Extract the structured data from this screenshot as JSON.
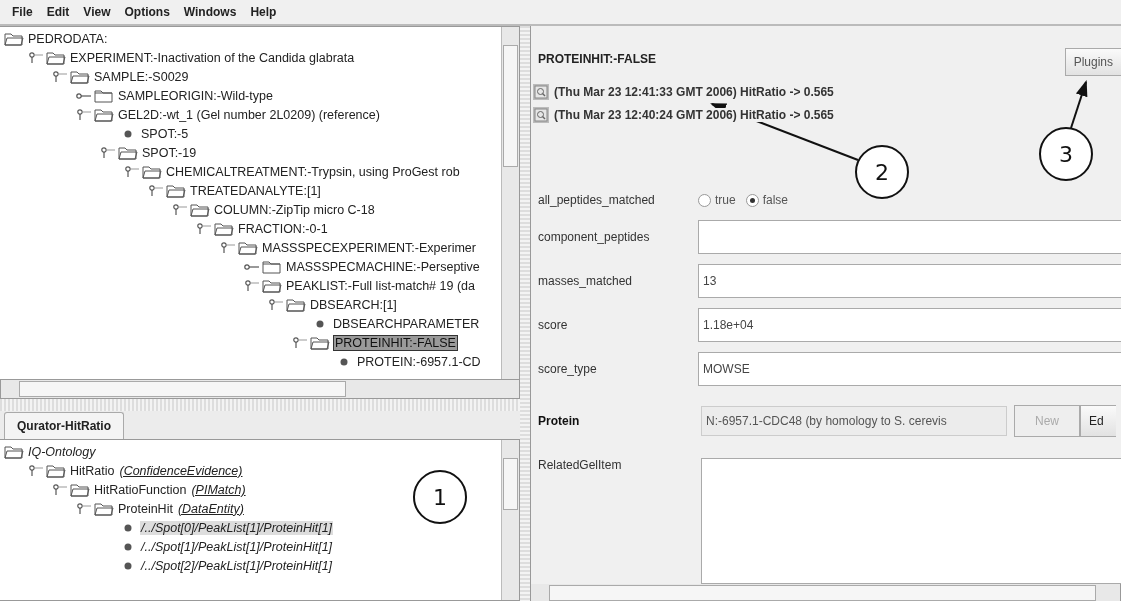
{
  "menu": [
    "File",
    "Edit",
    "View",
    "Options",
    "Windows",
    "Help"
  ],
  "top_tree": {
    "nodes": [
      {
        "label": "PEDRODATA:",
        "kind": "folder",
        "expanded": true,
        "selected": false,
        "children": [
          {
            "label": "EXPERIMENT:-Inactivation of the Candida glabrata",
            "kind": "folder",
            "expanded": true,
            "selected": false,
            "children": [
              {
                "label": "SAMPLE:-S0029",
                "kind": "folder",
                "expanded": true,
                "selected": false,
                "children": [
                  {
                    "label": "SAMPLEORIGIN:-Wild-type",
                    "kind": "folder",
                    "expanded": false,
                    "selected": false
                  },
                  {
                    "label": "GEL2D:-wt_1 (Gel number 2L0209) (reference)",
                    "kind": "folder",
                    "expanded": true,
                    "selected": false,
                    "children": [
                      {
                        "label": "SPOT:-5",
                        "kind": "leaf",
                        "selected": false
                      },
                      {
                        "label": "SPOT:-19",
                        "kind": "folder",
                        "expanded": true,
                        "selected": false,
                        "children": [
                          {
                            "label": "CHEMICALTREATMENT:-Trypsin, using ProGest rob",
                            "kind": "folder",
                            "expanded": true,
                            "selected": false,
                            "children": [
                              {
                                "label": "TREATEDANALYTE:[1]",
                                "kind": "folder",
                                "expanded": true,
                                "selected": false,
                                "children": [
                                  {
                                    "label": "COLUMN:-ZipTip micro C-18",
                                    "kind": "folder",
                                    "expanded": true,
                                    "selected": false,
                                    "children": [
                                      {
                                        "label": "FRACTION:-0-1",
                                        "kind": "folder",
                                        "expanded": true,
                                        "selected": false,
                                        "children": [
                                          {
                                            "label": "MASSSPECEXPERIMENT:-Experimer",
                                            "kind": "folder",
                                            "expanded": true,
                                            "selected": false,
                                            "children": [
                                              {
                                                "label": "MASSSPECMACHINE:-Perseptive",
                                                "kind": "folder",
                                                "expanded": false,
                                                "selected": false
                                              },
                                              {
                                                "label": "PEAKLIST:-Full list-match# 19 (da",
                                                "kind": "folder",
                                                "expanded": true,
                                                "selected": false,
                                                "children": [
                                                  {
                                                    "label": "DBSEARCH:[1]",
                                                    "kind": "folder",
                                                    "expanded": true,
                                                    "selected": false,
                                                    "children": [
                                                      {
                                                        "label": "DBSEARCHPARAMETER",
                                                        "kind": "leaf",
                                                        "selected": false
                                                      },
                                                      {
                                                        "label": "PROTEINHIT:-FALSE",
                                                        "kind": "folder",
                                                        "expanded": true,
                                                        "selected": true,
                                                        "children": [
                                                          {
                                                            "label": "PROTEIN:-6957.1-CD",
                                                            "kind": "leaf",
                                                            "selected": false
                                                          }
                                                        ]
                                                      }
                                                    ]
                                                  }
                                                ]
                                              }
                                            ]
                                          }
                                        ]
                                      }
                                    ]
                                  }
                                ]
                              }
                            ]
                          }
                        ]
                      }
                    ]
                  }
                ]
              }
            ]
          }
        ]
      }
    ]
  },
  "tab": {
    "label": "Qurator-HitRatio",
    "selected": true
  },
  "bottom_tree": {
    "nodes": [
      {
        "label": "IQ-Ontology",
        "kind": "folder",
        "expanded": true,
        "selected": false,
        "children": [
          {
            "label": "HitRatio",
            "type": "(ConfidenceEvidence)",
            "kind": "folder",
            "expanded": true,
            "selected": false,
            "children": [
              {
                "label": "HitRatioFunction",
                "type": "(PIMatch)",
                "kind": "folder",
                "expanded": true,
                "selected": false,
                "children": [
                  {
                    "label": "ProteinHit",
                    "type": "(DataEntity)",
                    "kind": "folder",
                    "expanded": true,
                    "selected": false,
                    "children": [
                      {
                        "label": "/../Spot[0]/PeakList[1]/ProteinHit[1]",
                        "kind": "leaf",
                        "selected": true
                      },
                      {
                        "label": "/../Spot[1]/PeakList[1]/ProteinHit[1]",
                        "kind": "leaf",
                        "selected": false
                      },
                      {
                        "label": "/../Spot[2]/PeakList[1]/ProteinHit[1]",
                        "kind": "leaf",
                        "selected": false
                      }
                    ]
                  }
                ]
              }
            ]
          }
        ]
      }
    ]
  },
  "detail": {
    "title": "PROTEINHIT:-FALSE",
    "plugins_button": "Plugins",
    "history": [
      "(Thu Mar 23 12:41:33 GMT 2006) HitRatio -> 0.565",
      "(Thu Mar 23 12:40:24 GMT 2006) HitRatio -> 0.565"
    ],
    "fields": [
      {
        "kind": "radio",
        "label": "all_peptides_matched",
        "options": [
          {
            "label": "true",
            "selected": false
          },
          {
            "label": "false",
            "selected": true
          }
        ]
      },
      {
        "kind": "text",
        "label": "component_peptides"
      },
      {
        "kind": "text",
        "label": "masses_matched",
        "value": "13"
      },
      {
        "kind": "text",
        "label": "score",
        "value": "1.18e+04"
      },
      {
        "kind": "text",
        "label": "score_type",
        "value": "MOWSE"
      },
      {
        "kind": "reference",
        "label": "Protein",
        "value": "N:-6957.1-CDC48 (by homology to S. cerevis",
        "buttons": [
          {
            "label": "New",
            "disabled": true
          },
          {
            "label": "Ed",
            "disabled": false
          }
        ]
      },
      {
        "kind": "area",
        "label": "RelatedGelItem"
      }
    ]
  },
  "callouts": [
    {
      "number": "1"
    },
    {
      "number": "2"
    },
    {
      "number": "3"
    }
  ]
}
